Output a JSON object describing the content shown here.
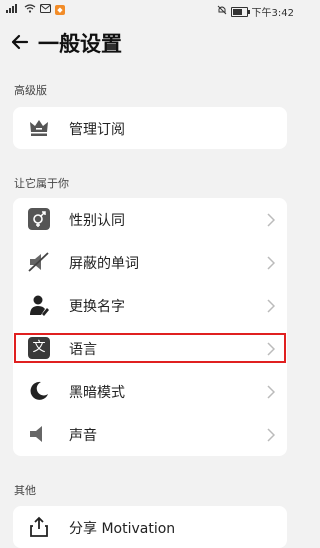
{
  "status_bar": {
    "carrier_signal": "4G",
    "time": "下午3:42"
  },
  "header": {
    "title": "一般设置"
  },
  "sections": [
    {
      "label": "高级版",
      "items": [
        {
          "label": "管理订阅",
          "icon": "crown-icon"
        }
      ]
    },
    {
      "label": "让它属于你",
      "items": [
        {
          "label": "性别认同",
          "icon": "gender-icon"
        },
        {
          "label": "屏蔽的单词",
          "icon": "mute-icon"
        },
        {
          "label": "更换名字",
          "icon": "person-edit-icon"
        },
        {
          "label": "语言",
          "icon": "language-icon"
        },
        {
          "label": "黑暗模式",
          "icon": "moon-icon"
        },
        {
          "label": "声音",
          "icon": "speaker-icon"
        }
      ]
    },
    {
      "label": "其他",
      "items": [
        {
          "label": "分享 Motivation",
          "icon": "share-icon"
        }
      ]
    }
  ],
  "colors": {
    "background": "#f2f2f2",
    "card": "#ffffff",
    "highlight": "#e02020",
    "badge": "#f28c28"
  }
}
